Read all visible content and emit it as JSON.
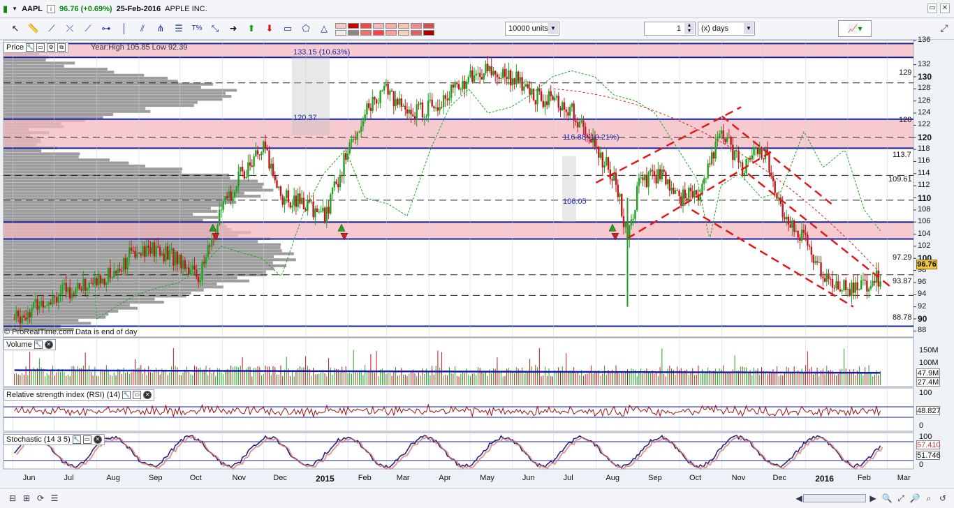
{
  "header": {
    "symbol": "AAPL",
    "change": "96.76 (+0.69%)",
    "date": "25-Feb-2016",
    "name": "APPLE INC.",
    "info": "i"
  },
  "toolbar": {
    "units_value": "10000 units",
    "quantity_value": "1",
    "period_value": "(x) days"
  },
  "price_panel": {
    "title": "Price",
    "range_text": "Year:High 105.85 Low 92.39",
    "watermark": "© ProRealTime.com  Data is end of day",
    "current_price": "96.76"
  },
  "volume_panel": {
    "title": "Volume",
    "tags": [
      "47.9M",
      "27.4M"
    ]
  },
  "rsi_panel": {
    "title": "Relative strength index (RSI) (14)",
    "value": "48.827"
  },
  "stoch_panel": {
    "title": "Stochastic (14 3 5)",
    "value1": "57.410",
    "value2": "51.746"
  },
  "annotations": [
    {
      "text": "133.15 (10.63%)"
    },
    {
      "text": "120.37"
    },
    {
      "text": "116.88 (10.21%)"
    },
    {
      "text": "106.05"
    }
  ],
  "hline_labels": [
    "129",
    "120",
    "113.7",
    "109.61",
    "97.29",
    "93.87",
    "88.78"
  ],
  "chart_data": {
    "type": "candlestick",
    "y_ticks": [
      "136",
      "132",
      "130",
      "128",
      "126",
      "124",
      "122",
      "120",
      "118",
      "116",
      "114",
      "112",
      "110",
      "108",
      "106",
      "104",
      "102",
      "100",
      "98",
      "96",
      "94",
      "92",
      "90",
      "88"
    ],
    "ylim": [
      87,
      136
    ],
    "x_ticks": [
      "Jun",
      "Jul",
      "Aug",
      "Sep",
      "Oct",
      "Nov",
      "Dec",
      "2015",
      "Feb",
      "Mar",
      "Apr",
      "May",
      "Jun",
      "Jul",
      "Aug",
      "Sep",
      "Oct",
      "Nov",
      "Dec",
      "2016",
      "Feb",
      "Mar"
    ],
    "resistance_levels": [
      135.5,
      133.2,
      129,
      123,
      120,
      118.2,
      113.7,
      109.61,
      106,
      103.2,
      97.29,
      93.87,
      88.78
    ],
    "pink_zones": [
      [
        133.2,
        135.5
      ],
      [
        118.2,
        123
      ],
      [
        103.2,
        106
      ]
    ],
    "close_series": [
      [
        "2014-06-02",
        90
      ],
      [
        "2014-06-16",
        92
      ],
      [
        "2014-07-01",
        94
      ],
      [
        "2014-07-15",
        95
      ],
      [
        "2014-08-01",
        96
      ],
      [
        "2014-08-15",
        98
      ],
      [
        "2014-09-01",
        102
      ],
      [
        "2014-09-15",
        101
      ],
      [
        "2014-10-01",
        100
      ],
      [
        "2014-10-15",
        97
      ],
      [
        "2014-11-01",
        108
      ],
      [
        "2014-11-15",
        114
      ],
      [
        "2014-12-01",
        118
      ],
      [
        "2014-12-15",
        110
      ],
      [
        "2015-01-01",
        109
      ],
      [
        "2015-01-15",
        107
      ],
      [
        "2015-02-01",
        118
      ],
      [
        "2015-02-15",
        125
      ],
      [
        "2015-03-01",
        128
      ],
      [
        "2015-03-15",
        124
      ],
      [
        "2015-04-01",
        125
      ],
      [
        "2015-04-15",
        127
      ],
      [
        "2015-05-01",
        130
      ],
      [
        "2015-05-15",
        131
      ],
      [
        "2015-06-01",
        130
      ],
      [
        "2015-06-15",
        127
      ],
      [
        "2015-07-01",
        126
      ],
      [
        "2015-07-15",
        124
      ],
      [
        "2015-08-01",
        118
      ],
      [
        "2015-08-15",
        113
      ],
      [
        "2015-08-24",
        103
      ],
      [
        "2015-09-01",
        112
      ],
      [
        "2015-09-15",
        114
      ],
      [
        "2015-10-01",
        110
      ],
      [
        "2015-10-15",
        111
      ],
      [
        "2015-11-01",
        121
      ],
      [
        "2015-11-15",
        115
      ],
      [
        "2015-12-01",
        118
      ],
      [
        "2015-12-15",
        108
      ],
      [
        "2016-01-01",
        103
      ],
      [
        "2016-01-15",
        97
      ],
      [
        "2016-02-01",
        95
      ],
      [
        "2016-02-15",
        96
      ],
      [
        "2016-02-25",
        96.76
      ]
    ]
  }
}
